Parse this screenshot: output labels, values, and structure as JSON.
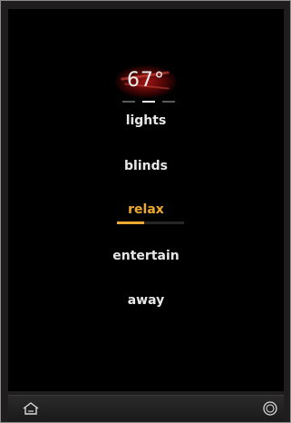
{
  "thermostat": {
    "temperature": "67°"
  },
  "pager": {
    "page_count": 3,
    "current_page": 2
  },
  "menu": {
    "items": [
      {
        "label": "lights"
      },
      {
        "label": "blinds"
      },
      {
        "label": "relax"
      },
      {
        "label": "entertain"
      },
      {
        "label": "away"
      }
    ],
    "active_index": 2,
    "active_level": 0.4
  },
  "bottom_bar": {
    "left_icon": "home-icon",
    "right_icon": "power-icon"
  },
  "colors": {
    "accent": "#eeaa2e",
    "temperature_glow": "#a01414",
    "text": "#e8e8e8",
    "screen": "#000000",
    "bezel": "#1f1d1d"
  }
}
